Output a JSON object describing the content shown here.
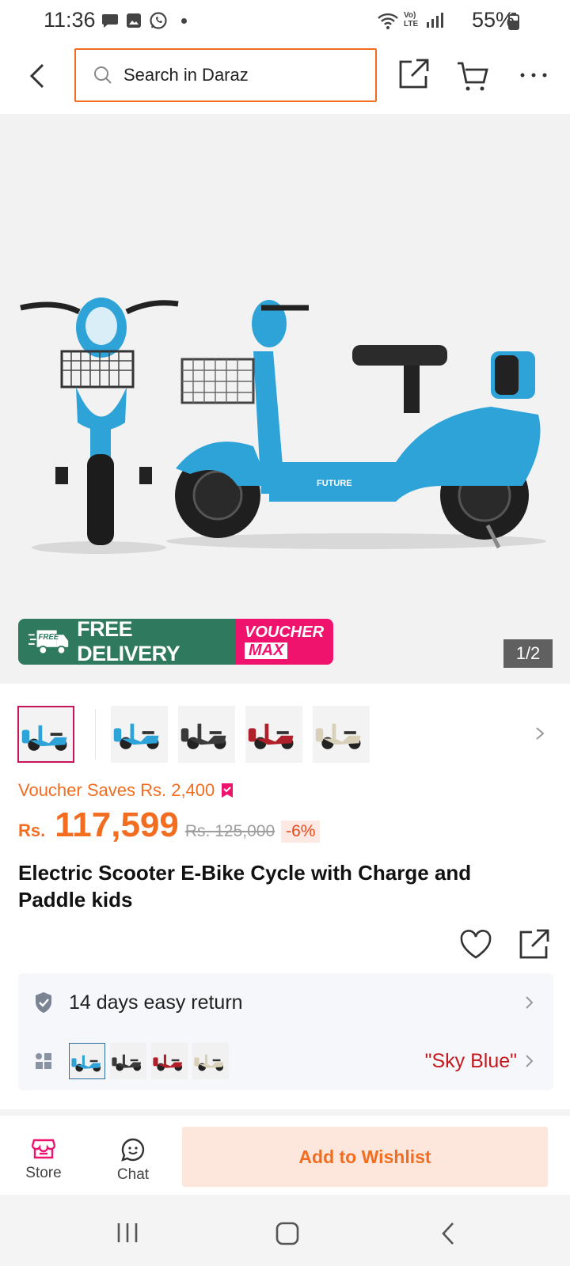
{
  "status_bar": {
    "time": "11:36",
    "network": "Vo) LTE",
    "battery": "55%"
  },
  "header": {
    "search_placeholder": "Search in Daraz",
    "icons": [
      "back-arrow-icon",
      "search-icon",
      "share-icon",
      "cart-icon",
      "more-icon"
    ]
  },
  "gallery": {
    "promo_free": "FREE DELIVERY",
    "promo_free_badge": "FREE",
    "promo_voucher_line1": "VOUCHER",
    "promo_voucher_line2": "MAX",
    "pager": "1/2",
    "brand_on_scooter": "FUTURE",
    "thumbnails": [
      {
        "color": "#2ea3d8",
        "active": true
      },
      {
        "color": "#2ea3d8",
        "active": false
      },
      {
        "color": "#3a3a3a",
        "active": false
      },
      {
        "color": "#b0202a",
        "active": false
      },
      {
        "color": "#d8d0b8",
        "active": false
      }
    ]
  },
  "price": {
    "voucher_text": "Voucher Saves Rs. 2,400",
    "currency": "Rs.",
    "amount": "117,599",
    "original": "Rs. 125,000",
    "discount": "-6%"
  },
  "product": {
    "title": "Electric Scooter E-Bike Cycle with Charge and Paddle kids"
  },
  "info": {
    "return_text": "14 days easy return",
    "selected_variant": "\"Sky Blue\"",
    "variant_colors": [
      "#2ea3d8",
      "#3a3a3a",
      "#b0202a",
      "#d8d0b8"
    ]
  },
  "bottom_bar": {
    "store_label": "Store",
    "chat_label": "Chat",
    "wishlist_label": "Add to Wishlist"
  },
  "colors": {
    "accent": "#f36d21",
    "promo_green": "#2f7a5e",
    "promo_pink": "#f0136e",
    "variant_red": "#c3191e"
  }
}
